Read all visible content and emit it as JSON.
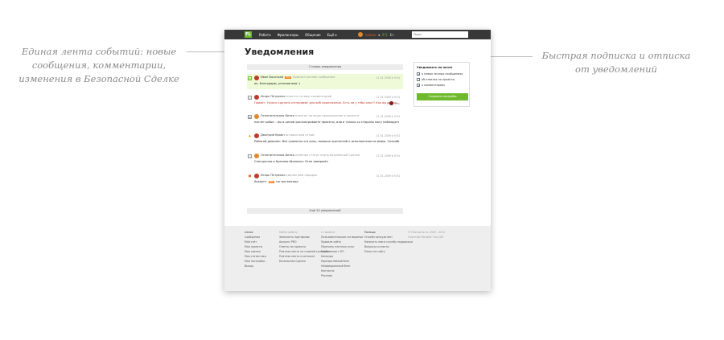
{
  "captions": {
    "left": "Единая лента событий: новые сообщения, комментарии, изменения в Безопасной Сделке",
    "right": "Быстрая подписка и отписка от уведомлений"
  },
  "topbar": {
    "logo": "FL",
    "nav": [
      "Работа",
      "Фрилансеры",
      "Общение",
      "Ещё ▾"
    ],
    "user_name": "ivanov",
    "user_chevron": "▾",
    "money": "₽ 5",
    "lang": "En",
    "search_placeholder": "Поиск"
  },
  "page": {
    "title": "Уведомления",
    "new_count": "2 новых уведомления",
    "more": "Ещё 20 уведомлений"
  },
  "notifications": [
    {
      "name": "Иван Васильев",
      "pro": "PRO",
      "action": "прислал личное сообщение",
      "text": "ок. Благодарю, успехов вам :)",
      "time": "11.01.2009 в 9:34",
      "icon": "✉"
    },
    {
      "name": "Игорь Петренко",
      "action": "ответил на ваш комментарий",
      "text": "Привет. Нужно сделать интерфейс для веб приложения. Есть ли у тебя опыт? Как вы оцени...",
      "time": "11.01.2009 в 9:34",
      "reply": "Ответить",
      "icon": "☐"
    },
    {
      "name": "Ослепительная Белка",
      "action": "ответил на ваше предложение в проекте",
      "text": "насчёт работ – вы в целом рассматриваете проекты, или в только со стороны могу наблюдать...",
      "time": "11.01.2009 в 9:34",
      "icon": "▤"
    },
    {
      "name": "Дмитрий Яркин",
      "action": "оставил вам отзыв",
      "text": "Работой доволен. Всё грамотно и в срок, никаких претензий к исполнителю не имею. Спасибо!",
      "time": "11.01.2009 в 9:34",
      "icon": "👍"
    },
    {
      "name": "Ослепительная Белка",
      "action": "изменил статус этапа Безопасной Сделки",
      "text": "Снегурочка и Красная Шапочка: Этап завершён",
      "time": "11.01.2009 в 9:34",
      "icon": "☐"
    },
    {
      "name": "Игорь Петренко",
      "action": "сделал вам подарок",
      "text_prefix": "Аккаунт",
      "pro": "PRO",
      "text_suffix": "на три месяца",
      "time": "11.01.2009 в 9:34",
      "icon": "🎁"
    }
  ],
  "subscribe": {
    "title": "Уведомлять на почте",
    "options": [
      {
        "label": "о новых личных сообщениях",
        "checked": true
      },
      {
        "label": "об ответах на проекты",
        "checked": false
      },
      {
        "label": "о комментариях",
        "checked": true
      }
    ],
    "save": "Сохранить настройки"
  },
  "footer": {
    "col1": [
      "Сообщения",
      "Мой счёт",
      "Мои проекты",
      "Мои сделки",
      "Моя статистика",
      "Мои настройки",
      "Выход"
    ],
    "col1_head": "ivanov",
    "col2_head": "Найти работу",
    "col2": [
      "Заполнить портфолио",
      "Аккаунт PRO",
      "Ответы на проекты",
      "Платное место на главной странице",
      "Платное место в каталоге",
      "Безопасная Сделка"
    ],
    "col3_head": "О проекте",
    "col3": [
      "Пользовательское соглашение",
      "Правила сайта",
      "Перечень платных услуг",
      "Требования к ПО",
      "Команда",
      "Корпоративный блог",
      "Неофициальный блог",
      "Контакты",
      "Реклама"
    ],
    "col4_head": "Помощь",
    "col4": [
      "Онлайн консультант",
      "Написать нам в службу поддержки",
      "Вопросы и ответы",
      "Поиск по сайту"
    ],
    "col5": [
      "© Free-lance.ru, 2005 - 2011",
      "Участник Rambler Топ-100"
    ]
  },
  "colors": {
    "accent_green": "#6fba2c",
    "topbar": "#383838",
    "pro_orange": "#ff7a1a"
  }
}
